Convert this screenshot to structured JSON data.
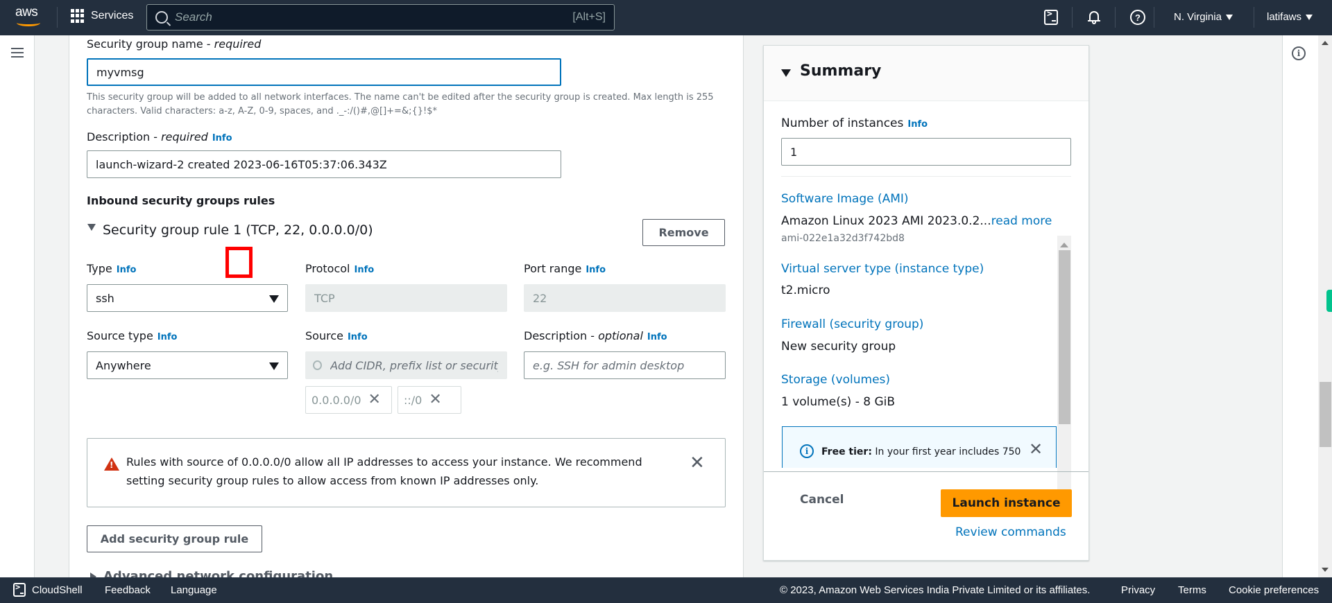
{
  "topnav": {
    "logo": "aws",
    "services_label": "Services",
    "search_placeholder": "Search",
    "search_shortcut": "[Alt+S]",
    "region": "N. Virginia",
    "account": "latifaws"
  },
  "form": {
    "sg_name_label": "Security group name - ",
    "sg_name_required": "required",
    "sg_name_value": "myvmsg",
    "sg_name_hint": "This security group will be added to all network interfaces. The name can't be edited after the security group is created. Max length is 255 characters. Valid characters: a-z, A-Z, 0-9, spaces, and ._-:/()#,@[]+=&;{}!$*",
    "description_label": "Description - ",
    "description_required": "required",
    "info": "Info",
    "description_value": "launch-wizard-2 created 2023-06-16T05:37:06.343Z",
    "inbound_heading": "Inbound security groups rules",
    "rule": {
      "title": "Security group rule 1 (TCP, 22, 0.0.0.0/0)",
      "remove_label": "Remove",
      "type_label": "Type",
      "type_value": "ssh",
      "protocol_label": "Protocol",
      "protocol_value": "TCP",
      "port_label": "Port range",
      "port_value": "22",
      "source_type_label": "Source type",
      "source_type_value": "Anywhere",
      "source_label": "Source",
      "source_placeholder": "Add CIDR, prefix list or security",
      "desc_label": "Description - ",
      "desc_optional": "optional",
      "desc_placeholder": "e.g. SSH for admin desktop",
      "tokens": [
        "0.0.0.0/0",
        "::/0"
      ]
    },
    "warning_text": "Rules with source of 0.0.0.0/0 allow all IP addresses to access your instance. We recommend setting security group rules to allow access from known IP addresses only.",
    "add_rule_label": "Add security group rule",
    "advanced_label": "Advanced network configuration"
  },
  "summary": {
    "title": "Summary",
    "instances_label": "Number of instances",
    "info": "Info",
    "instances_value": "1",
    "ami_label": "Software Image (AMI)",
    "ami_value": "Amazon Linux 2023 AMI 2023.0.2...",
    "ami_read_more": "read more",
    "ami_id": "ami-022e1a32d3f742bd8",
    "instance_type_label": "Virtual server type (instance type)",
    "instance_type_value": "t2.micro",
    "firewall_label": "Firewall (security group)",
    "firewall_value": "New security group",
    "storage_label": "Storage (volumes)",
    "storage_value": "1 volume(s) - 8 GiB",
    "free_tier_bold": "Free tier:",
    "free_tier_text": " In your first year includes 750",
    "cancel_label": "Cancel",
    "launch_label": "Launch instance",
    "review_label": "Review commands"
  },
  "footer": {
    "cloudshell": "CloudShell",
    "feedback": "Feedback",
    "language": "Language",
    "copyright": "© 2023, Amazon Web Services India Private Limited or its affiliates.",
    "privacy": "Privacy",
    "terms": "Terms",
    "cookies": "Cookie preferences"
  },
  "colors": {
    "nav_bg": "#232f3e",
    "accent_orange": "#ff9900",
    "link_blue": "#0073bb",
    "warning_red": "#d13212"
  }
}
